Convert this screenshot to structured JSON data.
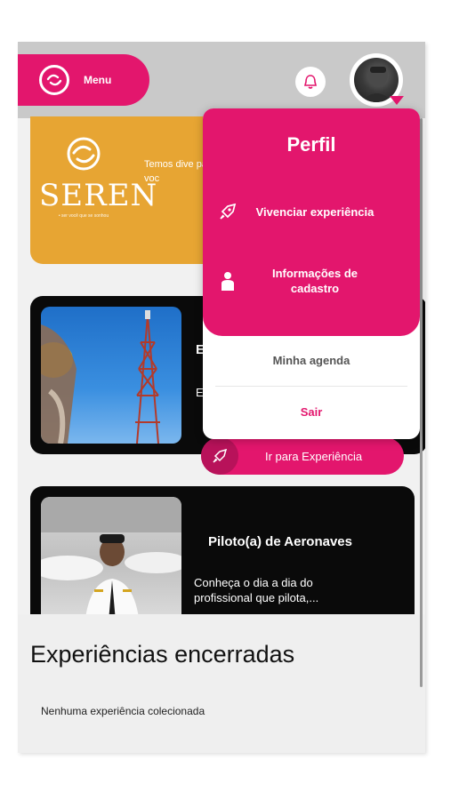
{
  "header": {
    "menu_label": "Menu"
  },
  "banner": {
    "logo_word": "SEREN",
    "logo_tagline": "• ser você que se sonhou",
    "text": "Temos dive para voc"
  },
  "cards": [
    {
      "title": "E",
      "description": "E e"
    },
    {
      "title": "Piloto(a) de Aeronaves",
      "description": "Conheça o dia a dia do profissional que pilota,..."
    }
  ],
  "go_button": {
    "label": "Ir para Experiência"
  },
  "closed_section": {
    "title": "Experiências encerradas",
    "empty_message": "Nenhuma experiência colecionada"
  },
  "profile_menu": {
    "title": "Perfil",
    "items": [
      {
        "label": "Vivenciar experiência",
        "icon": "rocket-icon"
      },
      {
        "label": "Informações de cadastro",
        "icon": "person-icon"
      }
    ],
    "agenda_label": "Minha agenda",
    "logout_label": "Sair"
  },
  "colors": {
    "brand_pink": "#e3166d",
    "banner_orange": "#e7a533",
    "card_dark": "#0a0a0a"
  }
}
